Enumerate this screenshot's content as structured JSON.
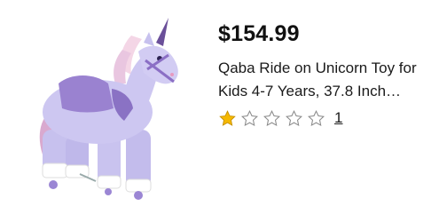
{
  "product": {
    "price": "$154.99",
    "title_line1": "Qaba Ride on Unicorn Toy for",
    "title_line2": "Kids 4-7 Years, 37.8 Inch…",
    "rating": 1,
    "rating_max": 5,
    "review_count": "1",
    "image_icon": "unicorn-ride-on-toy-image"
  },
  "colors": {
    "star_filled": "#f5b800",
    "star_outline": "#8a8a8a",
    "unicorn_body": "#c9c3ef",
    "unicorn_saddle": "#9a82d0",
    "horn": "#6a4f99"
  }
}
